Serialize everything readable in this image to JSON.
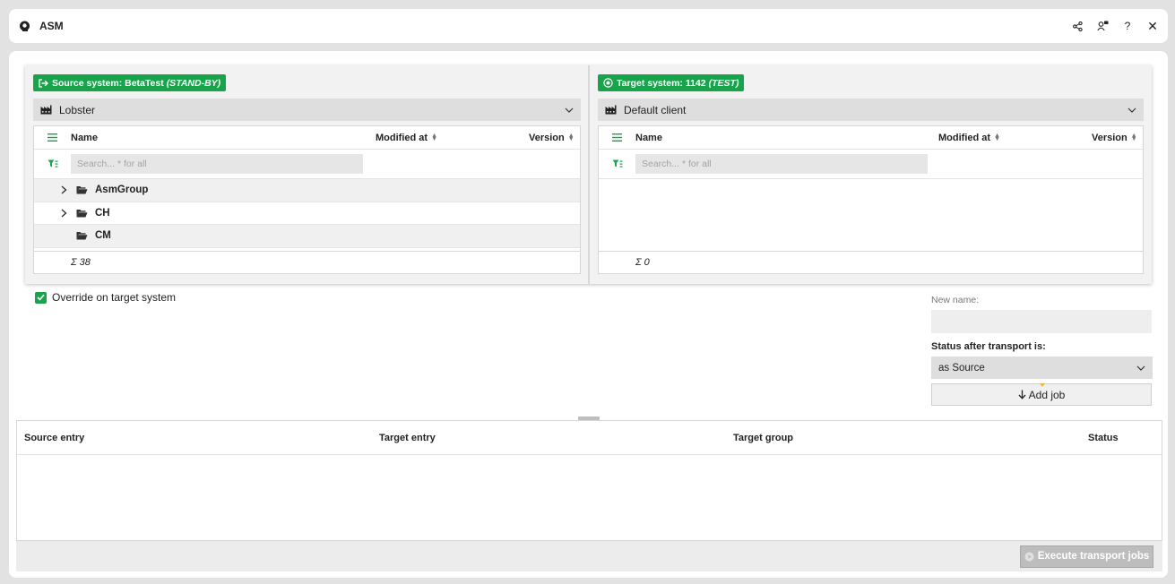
{
  "titlebar": {
    "title": "ASM",
    "icons": [
      "app-logo-icon",
      "share-icon",
      "user-chat-icon",
      "help-icon",
      "close-icon"
    ],
    "help_glyph": "?",
    "close_glyph": "✕"
  },
  "source": {
    "badge_label": "Source system: BetaTest",
    "badge_mode": "(STAND-BY)",
    "client": "Lobster",
    "columns": {
      "name": "Name",
      "modified": "Modified at",
      "version": "Version"
    },
    "search_placeholder": "Search... * for all",
    "rows": [
      {
        "label": "AsmGroup",
        "expandable": true
      },
      {
        "label": "CH",
        "expandable": true
      },
      {
        "label": "CM",
        "expandable": false
      }
    ],
    "total": "Σ 38"
  },
  "target": {
    "badge_label": "Target system: 1142",
    "badge_mode": "(TEST)",
    "client": "Default client",
    "columns": {
      "name": "Name",
      "modified": "Modified at",
      "version": "Version"
    },
    "search_placeholder": "Search... * for all",
    "rows": [],
    "total": "Σ 0"
  },
  "options": {
    "override_label": "Override on target system",
    "override_checked": true,
    "new_name_label": "New name:",
    "new_name_value": "",
    "status_label": "Status after transport is:",
    "status_value": "as Source",
    "add_job_label": "Add job"
  },
  "jobs": {
    "columns": [
      "Source entry",
      "Target entry",
      "Target group",
      "Status"
    ],
    "rows": []
  },
  "execute_label": "Execute transport jobs",
  "colors": {
    "accent": "#17a44b",
    "select_bg": "#dedede",
    "disabled": "#bdbdbd"
  }
}
